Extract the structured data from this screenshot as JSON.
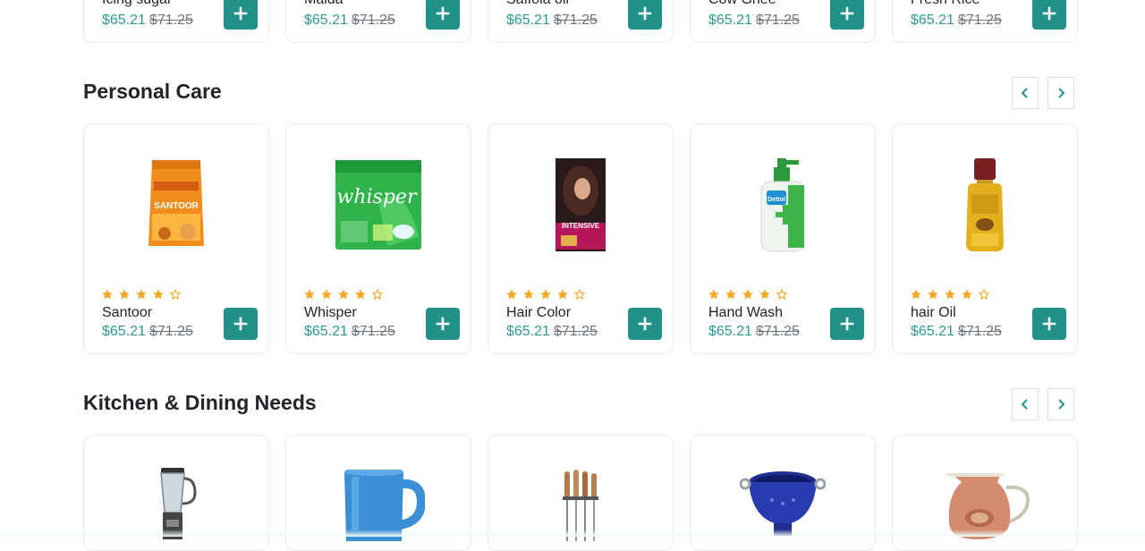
{
  "top_row": {
    "products": [
      {
        "name": "Icing sugar",
        "price": "$65.21",
        "old_price": "$71.25"
      },
      {
        "name": "Maida",
        "price": "$65.21",
        "old_price": "$71.25"
      },
      {
        "name": "Saffola oil",
        "price": "$65.21",
        "old_price": "$71.25"
      },
      {
        "name": "Cow Ghee",
        "price": "$65.21",
        "old_price": "$71.25"
      },
      {
        "name": "Fresh Rice",
        "price": "$65.21",
        "old_price": "$71.25"
      }
    ]
  },
  "personal_care": {
    "title": "Personal Care",
    "products": [
      {
        "name": "Santoor",
        "price": "$65.21",
        "old_price": "$71.25",
        "rating": 4,
        "rating_max": 5,
        "image_icon": "soap-pack-icon",
        "brand_text": "SANTOOR"
      },
      {
        "name": "Whisper",
        "price": "$65.21",
        "old_price": "$71.25",
        "rating": 4,
        "rating_max": 5,
        "image_icon": "pad-box-icon",
        "brand_text": "whisper"
      },
      {
        "name": "Hair Color",
        "price": "$65.21",
        "old_price": "$71.25",
        "rating": 4,
        "rating_max": 5,
        "image_icon": "hair-color-box-icon",
        "brand_text": "INTENSIVE"
      },
      {
        "name": "Hand Wash",
        "price": "$65.21",
        "old_price": "$71.25",
        "rating": 4,
        "rating_max": 5,
        "image_icon": "handwash-bottle-icon",
        "brand_text": "Dettol"
      },
      {
        "name": "hair Oil",
        "price": "$65.21",
        "old_price": "$71.25",
        "rating": 4,
        "rating_max": 5,
        "image_icon": "oil-bottle-icon",
        "brand_text": ""
      }
    ]
  },
  "kitchen": {
    "title": "Kitchen & Dining Needs",
    "products": [
      {
        "image_icon": "blender-icon"
      },
      {
        "image_icon": "mug-icon"
      },
      {
        "image_icon": "utensil-set-icon"
      },
      {
        "image_icon": "colander-icon"
      },
      {
        "image_icon": "copper-jug-icon"
      }
    ]
  },
  "icons": {
    "add": "plus-icon",
    "prev": "chevron-left-icon",
    "next": "chevron-right-icon",
    "star_filled": "star-filled-icon",
    "star_empty": "star-outline-icon"
  },
  "colors": {
    "accent": "#21918a",
    "price": "#2d9b93",
    "star": "#f5a623",
    "border": "#e9ecef"
  }
}
